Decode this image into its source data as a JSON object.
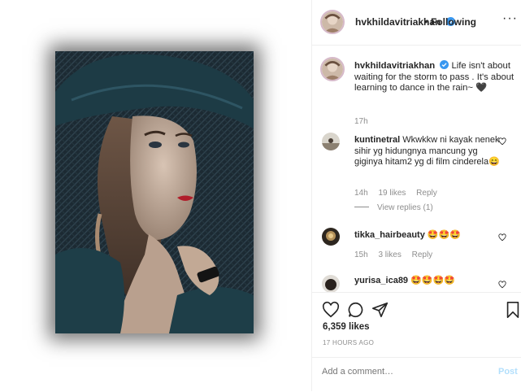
{
  "post": {
    "username": "hvkhildavitriakhan",
    "follow_status": "Following",
    "dot": "•",
    "more": "···"
  },
  "caption": {
    "username": "hvkhildavitriakhan",
    "text": "Life isn't about waiting for the storm to pass . It's about learning to dance in the rain~ 🖤",
    "age": "17h"
  },
  "comments": [
    {
      "username": "kuntinetral",
      "text": "Wkwkkw ni kayak nenek sihir yg hidungnya mancung yg giginya hitam2 yg di film cinderela😄",
      "age": "14h",
      "likes": "19 likes",
      "reply": "Reply",
      "view_replies": "View replies (1)"
    },
    {
      "username": "tikka_hairbeauty",
      "text": "🤩🤩🤩",
      "age": "15h",
      "likes": "3 likes",
      "reply": "Reply"
    },
    {
      "username": "yurisa_ica89",
      "text": "🤩🤩🤩🤩",
      "age": "",
      "likes": "",
      "reply": ""
    }
  ],
  "engagement": {
    "likes": "6,359 likes",
    "time": "17 HOURS AGO"
  },
  "composer": {
    "placeholder": "Add a comment…",
    "post_label": "Post"
  },
  "icons": {
    "like": "heart-icon",
    "comment": "comment-icon",
    "share": "share-icon",
    "save": "bookmark-icon",
    "verified": "verified-badge-icon"
  },
  "colors": {
    "verified": "#3897f0",
    "post_disabled": "#b2dffc",
    "muted": "#8e8e8e",
    "text": "#262626"
  }
}
